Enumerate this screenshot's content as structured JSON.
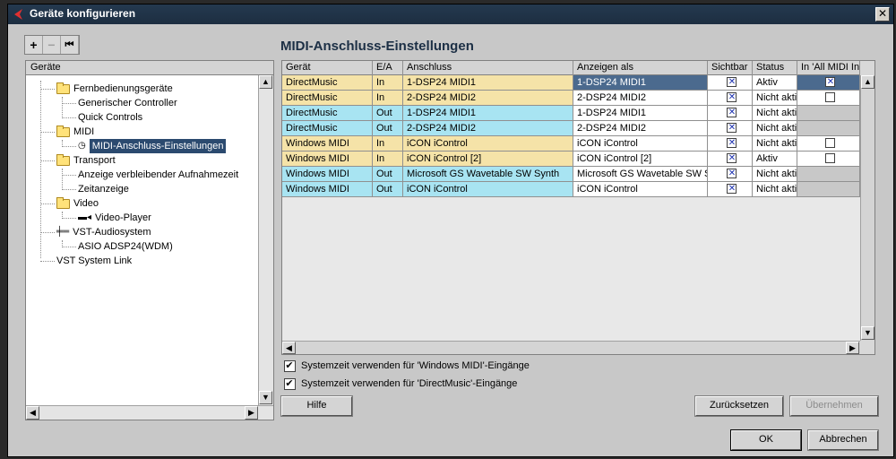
{
  "window": {
    "title": "Geräte konfigurieren",
    "close_glyph": "✕"
  },
  "toolbar": {
    "add": "+",
    "remove": "−",
    "reset": "⏮"
  },
  "tree": {
    "header": "Geräte",
    "nodes": [
      {
        "label": "Fernbedienungsgeräte",
        "icon": "folder-icon"
      },
      {
        "label": "Generischer Controller"
      },
      {
        "label": "Quick Controls"
      },
      {
        "label": "MIDI",
        "icon": "folder-icon"
      },
      {
        "label": "MIDI-Anschluss-Einstellungen",
        "icon": "midi-port-icon",
        "selected": true
      },
      {
        "label": "Transport",
        "icon": "folder-icon"
      },
      {
        "label": "Anzeige verbleibender Aufnahmezeit"
      },
      {
        "label": "Zeitanzeige"
      },
      {
        "label": "Video",
        "icon": "folder-icon"
      },
      {
        "label": "Video-Player",
        "icon": "video-icon"
      },
      {
        "label": "VST-Audiosystem",
        "icon": "audio-system-icon"
      },
      {
        "label": "ASIO ADSP24(WDM)"
      },
      {
        "label": "VST System Link"
      }
    ]
  },
  "section_title": "MIDI-Anschluss-Einstellungen",
  "grid": {
    "columns": [
      "Gerät",
      "E/A",
      "Anschluss",
      "Anzeigen als",
      "Sichtbar",
      "Status",
      "In 'All MIDI In"
    ],
    "rows": [
      {
        "geraet": "DirectMusic",
        "ea": "In",
        "anschluss": "1-DSP24 MIDI1",
        "anzeigen": "1-DSP24 MIDI1",
        "sichtbar": true,
        "status": "Aktiv",
        "allmidi": "checked",
        "selected": true
      },
      {
        "geraet": "DirectMusic",
        "ea": "In",
        "anschluss": "2-DSP24 MIDI2",
        "anzeigen": "2-DSP24 MIDI2",
        "sichtbar": true,
        "status": "Nicht akti",
        "allmidi": "unchecked"
      },
      {
        "geraet": "DirectMusic",
        "ea": "Out",
        "anschluss": "1-DSP24 MIDI1",
        "anzeigen": "1-DSP24 MIDI1",
        "sichtbar": true,
        "status": "Nicht akti",
        "allmidi": "none"
      },
      {
        "geraet": "DirectMusic",
        "ea": "Out",
        "anschluss": "2-DSP24 MIDI2",
        "anzeigen": "2-DSP24 MIDI2",
        "sichtbar": true,
        "status": "Nicht akti",
        "allmidi": "none"
      },
      {
        "geraet": "Windows MIDI",
        "ea": "In",
        "anschluss": "iCON iControl",
        "anzeigen": "iCON iControl",
        "sichtbar": true,
        "status": "Nicht akti",
        "allmidi": "unchecked"
      },
      {
        "geraet": "Windows MIDI",
        "ea": "In",
        "anschluss": "iCON iControl [2]",
        "anzeigen": "iCON iControl [2]",
        "sichtbar": true,
        "status": "Aktiv",
        "allmidi": "unchecked"
      },
      {
        "geraet": "Windows MIDI",
        "ea": "Out",
        "anschluss": "Microsoft GS Wavetable SW Synth",
        "anzeigen": "Microsoft GS Wavetable SW S",
        "sichtbar": true,
        "status": "Nicht akti",
        "allmidi": "none"
      },
      {
        "geraet": "Windows MIDI",
        "ea": "Out",
        "anschluss": "iCON iControl",
        "anzeigen": "iCON iControl",
        "sichtbar": true,
        "status": "Nicht akti",
        "allmidi": "none"
      }
    ],
    "in_color": "#f5e3a8",
    "out_color": "#a8e4f2",
    "selected_color": "#4b6a8e"
  },
  "options": {
    "windows_midi": {
      "label": "Systemzeit verwenden für 'Windows MIDI'-Eingänge",
      "checked": true
    },
    "directmusic": {
      "label": "Systemzeit verwenden für 'DirectMusic'-Eingänge",
      "checked": true
    }
  },
  "buttons": {
    "help": "Hilfe",
    "reset": "Zurücksetzen",
    "apply": "Übernehmen",
    "ok": "OK",
    "cancel": "Abbrechen"
  },
  "scroll": {
    "up": "▲",
    "down": "▼",
    "left": "◀",
    "right": "▶"
  }
}
